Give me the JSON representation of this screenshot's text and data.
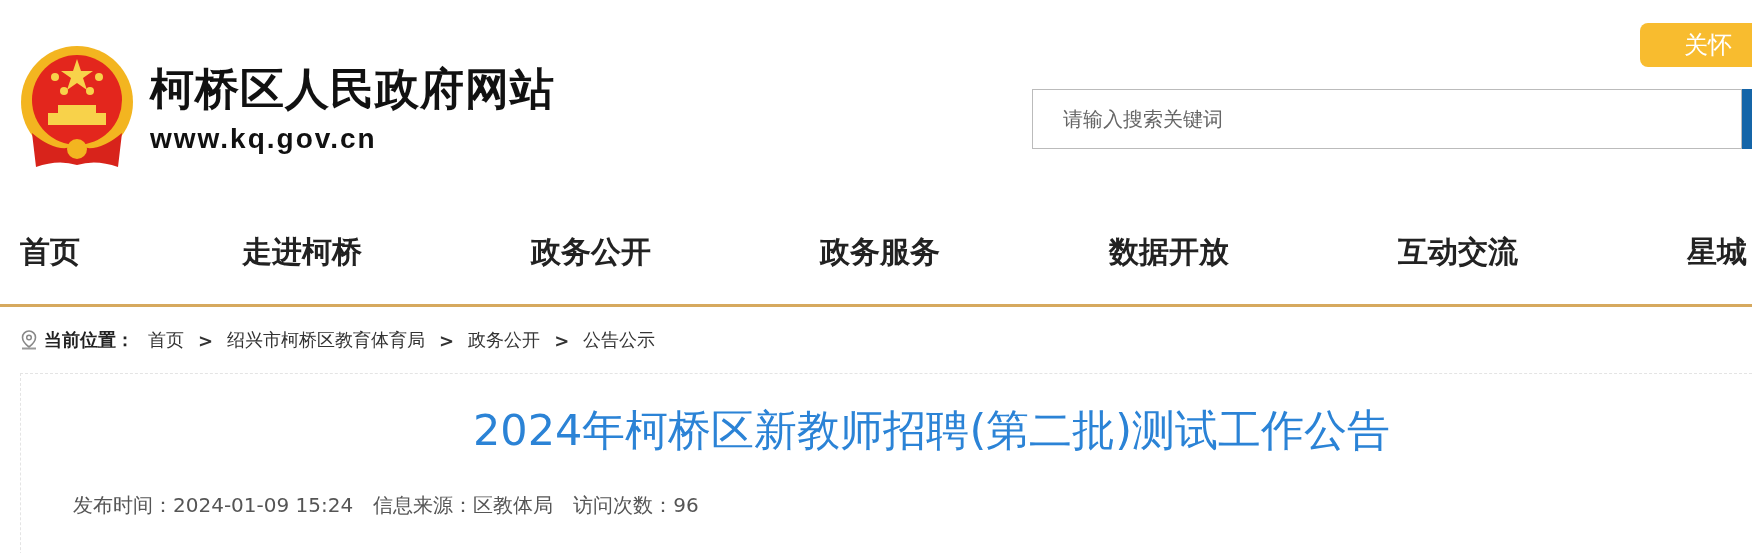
{
  "header": {
    "site_title": "柯桥区人民政府网站",
    "site_url": "www.kq.gov.cn",
    "care_button": "关怀",
    "search": {
      "placeholder": "请输入搜索关键词"
    }
  },
  "nav": [
    {
      "label": "首页"
    },
    {
      "label": "走进柯桥"
    },
    {
      "label": "政务公开"
    },
    {
      "label": "政务服务"
    },
    {
      "label": "数据开放"
    },
    {
      "label": "互动交流"
    },
    {
      "label": "星城"
    }
  ],
  "breadcrumb": {
    "label": "当前位置：",
    "items": [
      "首页",
      "绍兴市柯桥区教育体育局",
      "政务公开",
      "公告公示"
    ],
    "separator": ">"
  },
  "article": {
    "title": "2024年柯桥区新教师招聘(第二批)测试工作公告",
    "meta": [
      "发布时间：2024-01-09 15:24",
      "信息来源：区教体局",
      "访问次数：96"
    ]
  }
}
